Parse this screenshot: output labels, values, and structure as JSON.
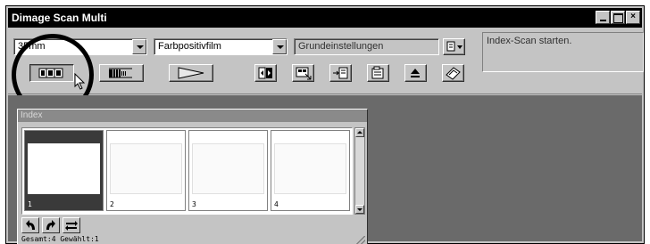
{
  "window": {
    "title": "Dimage Scan Multi",
    "controls": [
      "minimize",
      "maximize",
      "close"
    ],
    "close_label": "×"
  },
  "toolbar": {
    "film_format": {
      "value": "35mm"
    },
    "film_type": {
      "value": "Farbpositivfilm"
    },
    "settings": {
      "value": "Grundeinstellungen"
    },
    "message": "Index-Scan starten.",
    "scan_buttons": [
      {
        "name": "index-scan",
        "icon": "index-scan-icon",
        "pressed": true
      },
      {
        "name": "prescan",
        "icon": "prescan-icon",
        "pressed": false
      },
      {
        "name": "scan",
        "icon": "scan-arrow-icon",
        "pressed": false
      }
    ],
    "tool_buttons": [
      {
        "name": "flip",
        "icon": "flip-icon"
      },
      {
        "name": "crop",
        "icon": "crop-icon"
      },
      {
        "name": "export",
        "icon": "export-icon"
      },
      {
        "name": "preferences",
        "icon": "preferences-icon"
      },
      {
        "name": "eject",
        "icon": "eject-icon"
      },
      {
        "name": "help",
        "icon": "help-book-icon"
      }
    ]
  },
  "index_panel": {
    "title": "Index",
    "thumbnails": [
      {
        "label": "1",
        "selected": true
      },
      {
        "label": "2",
        "selected": false
      },
      {
        "label": "3",
        "selected": false
      },
      {
        "label": "4",
        "selected": false
      }
    ],
    "status": "Gesamt:4 Gewählt:1",
    "buttons": [
      "rotate-left-icon",
      "rotate-right-icon",
      "swap-icon"
    ]
  },
  "colors": {
    "window_bg": "#c4c4c4",
    "title_bg": "#000000",
    "workspace_bg": "#6a6a6a",
    "selected_thumb": "#3a3a3a"
  }
}
